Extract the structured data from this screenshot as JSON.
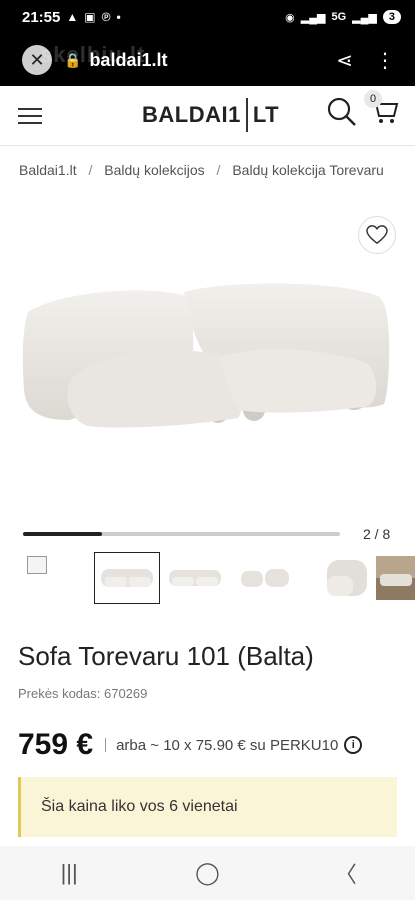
{
  "status_bar": {
    "time": "21:55",
    "signal_label": "5G",
    "battery": "3"
  },
  "browser": {
    "url": "baldai1.lt",
    "watermark": "skelbiu.lt"
  },
  "header": {
    "logo_left": "BALDAI1",
    "logo_right": "LT",
    "cart_count": "0"
  },
  "breadcrumb": [
    "Baldai1.lt",
    "Baldų kolekcijos",
    "Baldų kolekcija Torevaru"
  ],
  "gallery": {
    "counter": "2 / 8",
    "progress": 0.25,
    "thumbnail_count": 6
  },
  "product": {
    "title": "Sofa Torevaru 101 (Balta)",
    "sku": "Prekės kodas: 670269",
    "price": "759 €",
    "installment": "arba ~ 10 x 75.90 € su PERKU10",
    "info_icon": "i"
  },
  "notice": {
    "text": "Šia kaina liko vos 6 vienetai"
  },
  "colors": {
    "notice_bg": "#fbf5d8",
    "notice_border": "#e2c85b",
    "sofa": "#ebe8e3"
  }
}
